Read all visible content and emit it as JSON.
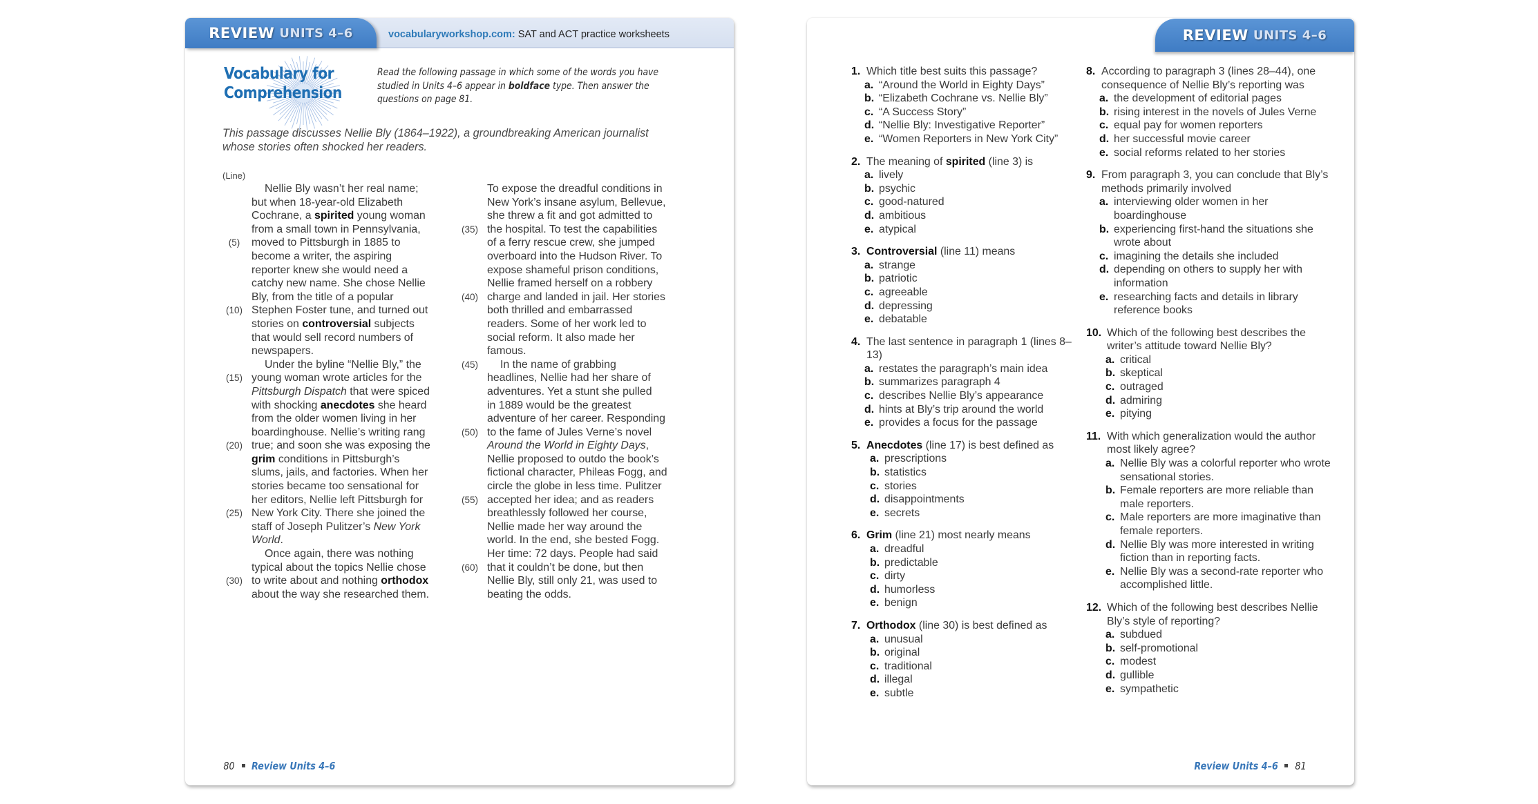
{
  "left_page": {
    "tab": {
      "review": "REVIEW",
      "units": "UNITS 4–6"
    },
    "site": {
      "url": "vocabularyworkshop.com:",
      "text": "SAT and ACT practice worksheets"
    },
    "section_title": [
      "Vocabulary for",
      "Comprehension"
    ],
    "instructions": {
      "pre": "Read the following passage in which some of the words you have studied in Units 4–6 appear in ",
      "bold": "boldface",
      "post": " type. Then answer the questions on page 81."
    },
    "intro": "This passage discusses Nellie Bly (1864–1922), a groundbreaking American journalist whose stories often shocked her readers.",
    "line_label": "(Line)",
    "passage_col1": [
      {
        "n": "",
        "indent": true,
        "t": "Nellie Bly wasn’t her real name;"
      },
      {
        "n": "",
        "t": "but when 18-year-old Elizabeth"
      },
      {
        "n": "",
        "t": "Cochrane, a **spirited** young woman"
      },
      {
        "n": "",
        "t": "from a small town in Pennsylvania,"
      },
      {
        "n": "(5)",
        "t": "moved to Pittsburgh in 1885 to"
      },
      {
        "n": "",
        "t": "become a writer, the aspiring"
      },
      {
        "n": "",
        "t": "reporter knew she would need a"
      },
      {
        "n": "",
        "t": "catchy new name. She chose Nellie"
      },
      {
        "n": "",
        "t": "Bly, from the title of a popular"
      },
      {
        "n": "(10)",
        "t": "Stephen Foster tune, and turned out"
      },
      {
        "n": "",
        "t": "stories on **controversial** subjects"
      },
      {
        "n": "",
        "t": "that would sell record numbers of"
      },
      {
        "n": "",
        "t": "newspapers."
      },
      {
        "n": "",
        "indent": true,
        "t": "Under the byline “Nellie Bly,” the"
      },
      {
        "n": "(15)",
        "t": "young woman wrote articles for the"
      },
      {
        "n": "",
        "t": "_Pittsburgh Dispatch_ that were spiced"
      },
      {
        "n": "",
        "t": "with shocking **anecdotes** she heard"
      },
      {
        "n": "",
        "t": "from the older women living in her"
      },
      {
        "n": "",
        "t": "boardinghouse. Nellie’s writing rang"
      },
      {
        "n": "(20)",
        "t": "true; and soon she was exposing the"
      },
      {
        "n": "",
        "t": "**grim** conditions in Pittsburgh’s"
      },
      {
        "n": "",
        "t": "slums, jails, and factories. When her"
      },
      {
        "n": "",
        "t": "stories became too sensational for"
      },
      {
        "n": "",
        "t": "her editors, Nellie left Pittsburgh for"
      },
      {
        "n": "(25)",
        "t": "New York City. There she joined the"
      },
      {
        "n": "",
        "t": "staff of Joseph Pulitzer’s _New York_"
      },
      {
        "n": "",
        "t": "_World_."
      },
      {
        "n": "",
        "indent": true,
        "t": "Once again, there was nothing"
      },
      {
        "n": "",
        "t": "typical about the topics Nellie chose"
      },
      {
        "n": "(30)",
        "t": "to write about and nothing **orthodox**"
      },
      {
        "n": "",
        "t": "about the way she researched them."
      }
    ],
    "passage_col2": [
      {
        "n": "",
        "t": "To expose the dreadful conditions in"
      },
      {
        "n": "",
        "t": "New York’s insane asylum, Bellevue,"
      },
      {
        "n": "",
        "t": "she threw a fit and got admitted to"
      },
      {
        "n": "(35)",
        "t": "the hospital. To test the capabilities"
      },
      {
        "n": "",
        "t": "of a ferry rescue crew, she jumped"
      },
      {
        "n": "",
        "t": "overboard into the Hudson River. To"
      },
      {
        "n": "",
        "t": "expose shameful prison conditions,"
      },
      {
        "n": "",
        "t": "Nellie framed herself on a robbery"
      },
      {
        "n": "(40)",
        "t": "charge and landed in jail. Her stories"
      },
      {
        "n": "",
        "t": "both thrilled and embarrassed"
      },
      {
        "n": "",
        "t": "readers. Some of her work led to"
      },
      {
        "n": "",
        "t": "social reform. It also made her"
      },
      {
        "n": "",
        "t": "famous."
      },
      {
        "n": "(45)",
        "indent": true,
        "t": "In the name of grabbing"
      },
      {
        "n": "",
        "t": "headlines, Nellie had her share of"
      },
      {
        "n": "",
        "t": "adventures. Yet a stunt she pulled"
      },
      {
        "n": "",
        "t": "in 1889 would be the greatest"
      },
      {
        "n": "",
        "t": "adventure of her career. Responding"
      },
      {
        "n": "(50)",
        "t": "to the fame of Jules Verne’s novel"
      },
      {
        "n": "",
        "t": "_Around the World in Eighty Days_,"
      },
      {
        "n": "",
        "t": "Nellie proposed to outdo the book’s"
      },
      {
        "n": "",
        "t": "fictional character, Phileas Fogg, and"
      },
      {
        "n": "",
        "t": "circle the globe in less time. Pulitzer"
      },
      {
        "n": "(55)",
        "t": "accepted her idea; and as readers"
      },
      {
        "n": "",
        "t": "breathlessly followed her course,"
      },
      {
        "n": "",
        "t": "Nellie made her way around the"
      },
      {
        "n": "",
        "t": "world. In the end, she bested Fogg."
      },
      {
        "n": "",
        "t": "Her time: 72 days. People had said"
      },
      {
        "n": "(60)",
        "t": "that it couldn’t be done, but then"
      },
      {
        "n": "",
        "t": "Nellie Bly, still only 21, was used to"
      },
      {
        "n": "",
        "t": "beating the odds."
      }
    ],
    "footer": {
      "page": "80",
      "title": "Review Units 4–6"
    }
  },
  "right_page": {
    "tab": {
      "review": "REVIEW",
      "units": "UNITS 4–6"
    },
    "questions_col1": [
      {
        "num": "1.",
        "q": "Which title best suits this passage?",
        "opts": [
          [
            "a.",
            "“Around the World in Eighty Days”"
          ],
          [
            "b.",
            "“Elizabeth Cochrane vs. Nellie Bly”"
          ],
          [
            "c.",
            "“A Success Story”"
          ],
          [
            "d.",
            "“Nellie Bly: Investigative Reporter”"
          ],
          [
            "e.",
            "“Women Reporters in New York City”"
          ]
        ]
      },
      {
        "num": "2.",
        "q": "The meaning of **spirited** (line 3) is",
        "opts": [
          [
            "a.",
            "lively"
          ],
          [
            "b.",
            "psychic"
          ],
          [
            "c.",
            "good-natured"
          ],
          [
            "d.",
            "ambitious"
          ],
          [
            "e.",
            "atypical"
          ]
        ]
      },
      {
        "num": "3.",
        "q": "**Controversial** (line 11) means",
        "opts": [
          [
            "a.",
            "strange"
          ],
          [
            "b.",
            "patriotic"
          ],
          [
            "c.",
            "agreeable"
          ],
          [
            "d.",
            "depressing"
          ],
          [
            "e.",
            "debatable"
          ]
        ]
      },
      {
        "num": "4.",
        "q": "The last sentence in paragraph 1 (lines 8–13)",
        "opts": [
          [
            "a.",
            "restates the paragraph’s main idea"
          ],
          [
            "b.",
            "summarizes paragraph 4"
          ],
          [
            "c.",
            "describes Nellie Bly’s appearance"
          ],
          [
            "d.",
            "hints at Bly’s trip around the world"
          ],
          [
            "e.",
            "provides a focus for the passage"
          ]
        ]
      },
      {
        "num": "5.",
        "q": "**Anecdotes** (line 17) is best defined as",
        "indent2": true,
        "opts": [
          [
            "a.",
            "prescriptions"
          ],
          [
            "b.",
            "statistics"
          ],
          [
            "c.",
            "stories"
          ],
          [
            "d.",
            "disappointments"
          ],
          [
            "e.",
            "secrets"
          ]
        ]
      },
      {
        "num": "6.",
        "q": "**Grim** (line 21) most nearly means",
        "indent2": true,
        "opts": [
          [
            "a.",
            "dreadful"
          ],
          [
            "b.",
            "predictable"
          ],
          [
            "c.",
            "dirty"
          ],
          [
            "d.",
            "humorless"
          ],
          [
            "e.",
            "benign"
          ]
        ]
      },
      {
        "num": "7.",
        "q": "**Orthodox** (line 30) is best defined as",
        "indent2": true,
        "opts": [
          [
            "a.",
            "unusual"
          ],
          [
            "b.",
            "original"
          ],
          [
            "c.",
            "traditional"
          ],
          [
            "d.",
            "illegal"
          ],
          [
            "e.",
            "subtle"
          ]
        ]
      }
    ],
    "questions_col2": [
      {
        "num": "8.",
        "q": "According to paragraph 3 (lines 28–44), one consequence of Nellie Bly’s reporting was",
        "opts": [
          [
            "a.",
            "the development of editorial pages"
          ],
          [
            "b.",
            "rising interest in the novels of Jules Verne"
          ],
          [
            "c.",
            "equal pay for women reporters"
          ],
          [
            "d.",
            "her successful movie career"
          ],
          [
            "e.",
            "social reforms related to her stories"
          ]
        ]
      },
      {
        "num": "9.",
        "q": "From paragraph 3, you can conclude that Bly’s methods primarily involved",
        "opts": [
          [
            "a.",
            "interviewing older women in her boardinghouse"
          ],
          [
            "b.",
            "experiencing first-hand the situations she wrote about"
          ],
          [
            "c.",
            "imagining the details she included"
          ],
          [
            "d.",
            "depending on others to supply her with information"
          ],
          [
            "e.",
            "researching facts and details in library reference books"
          ]
        ]
      },
      {
        "num": "10.",
        "wide": true,
        "q": "Which of the following best describes the writer’s attitude toward Nellie Bly?",
        "opts": [
          [
            "a.",
            "critical"
          ],
          [
            "b.",
            "skeptical"
          ],
          [
            "c.",
            "outraged"
          ],
          [
            "d.",
            "admiring"
          ],
          [
            "e.",
            "pitying"
          ]
        ]
      },
      {
        "num": "11.",
        "wide": true,
        "q": "With which generalization would the author most likely agree?",
        "opts": [
          [
            "a.",
            "Nellie Bly was a colorful reporter who wrote sensational stories."
          ],
          [
            "b.",
            "Female reporters are more reliable than male reporters."
          ],
          [
            "c.",
            "Male reporters are more imaginative than female reporters."
          ],
          [
            "d.",
            "Nellie Bly was more interested in writing fiction than in reporting facts."
          ],
          [
            "e.",
            "Nellie Bly was a second-rate reporter who accomplished little."
          ]
        ]
      },
      {
        "num": "12.",
        "wide": true,
        "q": "Which of the following best describes Nellie Bly’s style of reporting?",
        "opts": [
          [
            "a.",
            "subdued"
          ],
          [
            "b.",
            "self-promotional"
          ],
          [
            "c.",
            "modest"
          ],
          [
            "d.",
            "gullible"
          ],
          [
            "e.",
            "sympathetic"
          ]
        ]
      }
    ],
    "footer": {
      "page": "81",
      "title": "Review Units 4–6"
    }
  },
  "colors": {
    "accent_blue": "#3f7cc4",
    "title_blue": "#1f6fb3",
    "url_blue": "#2e7ab8",
    "band": "#dfe7f4"
  }
}
